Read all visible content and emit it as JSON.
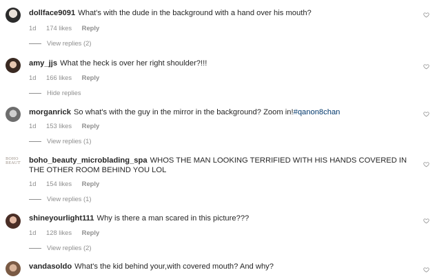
{
  "comments": [
    {
      "username": "dollface9091",
      "text": "What's with the dude in the background with a hand over his mouth?",
      "hashtag": "",
      "time": "1d",
      "likes": "174 likes",
      "reply_label": "Reply",
      "replies_label": "View replies (2)",
      "avatar_icon": "avatar-photo-icon"
    },
    {
      "username": "amy_jjs",
      "text": "What the heck is over her right shoulder?!!!",
      "hashtag": "",
      "time": "1d",
      "likes": "166 likes",
      "reply_label": "Reply",
      "replies_label": "Hide replies",
      "avatar_icon": "avatar-photo-icon"
    },
    {
      "username": "morganrick",
      "text": "So what's with the guy in the mirror in the background? Zoom in!",
      "hashtag": "#qanon8chan",
      "time": "1d",
      "likes": "153 likes",
      "reply_label": "Reply",
      "replies_label": "View replies (1)",
      "avatar_icon": "avatar-photo-icon"
    },
    {
      "username": "boho_beauty_microblading_spa",
      "text": "WHOS THE MAN LOOKING TERRIFIED WITH HIS HANDS COVERED IN THE OTHER ROOM BEHIND YOU LOL",
      "hashtag": "",
      "time": "1d",
      "likes": "154 likes",
      "reply_label": "Reply",
      "replies_label": "View replies (1)",
      "avatar_icon": "boho-beauty-logo-icon",
      "avatar_logo_text": "BOHO BEAUTY"
    },
    {
      "username": "shineyourlight111",
      "text": "Why is there a man scared in this picture???",
      "hashtag": "",
      "time": "1d",
      "likes": "128 likes",
      "reply_label": "Reply",
      "replies_label": "View replies (2)",
      "avatar_icon": "avatar-photo-icon"
    },
    {
      "username": "vandasoldo",
      "text": "What's the kid behind your,with covered mouth? And why?",
      "hashtag": "",
      "time": "",
      "likes": "",
      "reply_label": "",
      "replies_label": "",
      "avatar_icon": "avatar-photo-icon"
    }
  ],
  "colors": {
    "text": "#262626",
    "secondary": "#8e8e8e",
    "hashtag": "#00376b"
  }
}
